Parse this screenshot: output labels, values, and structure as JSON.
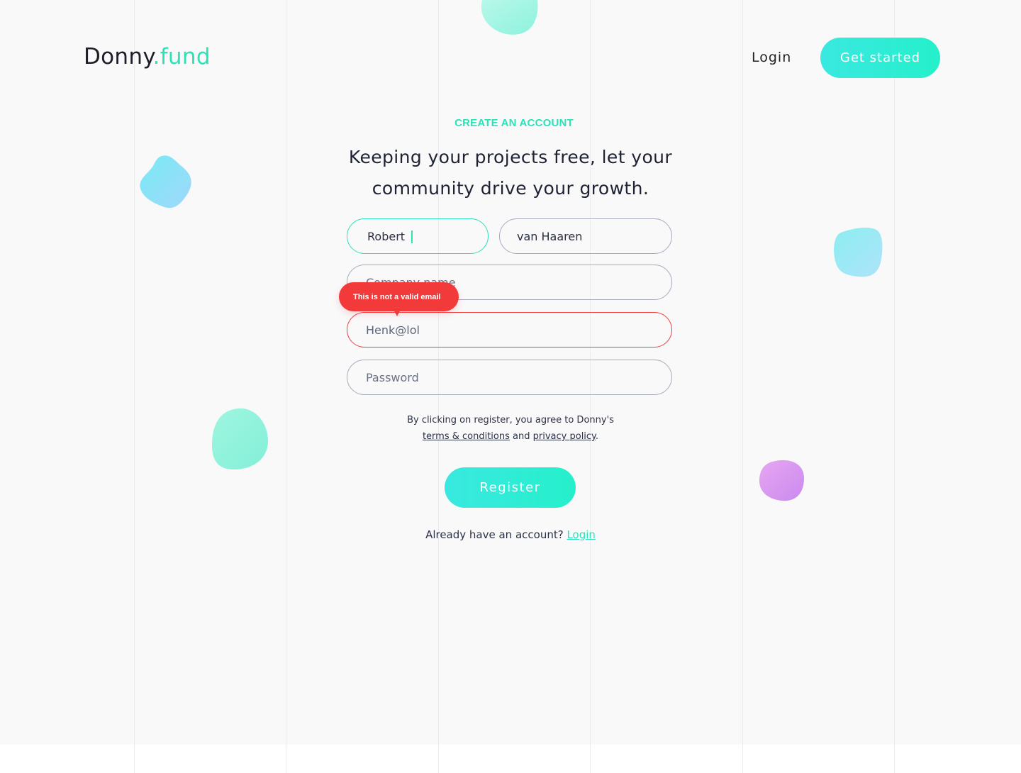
{
  "brand": {
    "logo_main": "Donny",
    "logo_accent": ".fund",
    "accent_color": "#2ce2b7",
    "button_gradient": [
      "#3ae8e0",
      "#25f0cb"
    ],
    "error_color": "#f23a3a"
  },
  "nav": {
    "login_label": "Login",
    "get_started_label": "Get started"
  },
  "form": {
    "eyebrow": "CREATE AN ACCOUNT",
    "headline": "Keeping your projects free, let your community drive your growth.",
    "first_name": {
      "value": "Robert",
      "state": "focused"
    },
    "last_name": {
      "value": "van Haaren"
    },
    "company": {
      "placeholder": "Company name",
      "value": ""
    },
    "email": {
      "value": "Henk@lol",
      "state": "error"
    },
    "email_error": "This is not a valid email",
    "password": {
      "placeholder": "Password",
      "value": ""
    },
    "terms_prefix": "By clicking on register, you agree to Donny's",
    "terms_link": "terms & conditions",
    "terms_and": "and",
    "privacy_link": "privacy policy",
    "terms_suffix": ".",
    "register_label": "Register",
    "already_text": "Already have an account?",
    "already_login_link": "Login"
  },
  "decor": {
    "blob_colors": [
      "#7de6f3",
      "#86f4d9",
      "#d58cf0"
    ]
  }
}
